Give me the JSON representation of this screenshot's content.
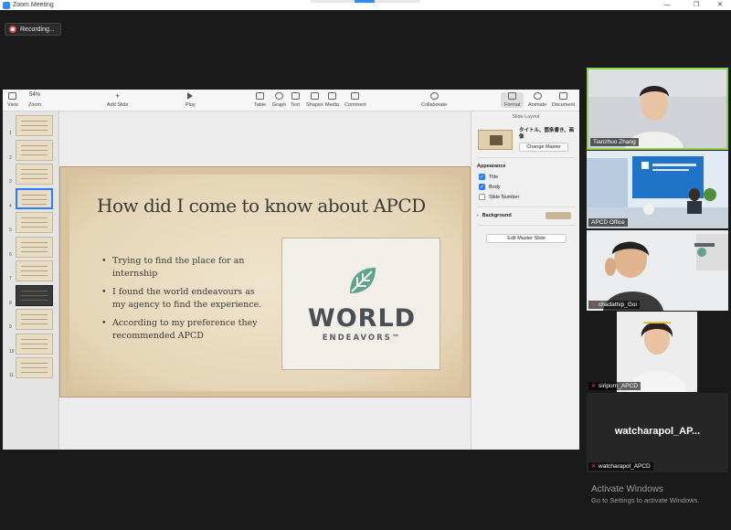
{
  "window": {
    "title": "Zoom Meeting"
  },
  "recording": {
    "label": "Recording..."
  },
  "keynote": {
    "toolbar": {
      "view": "View",
      "zoom_value": "54%",
      "zoom": "Zoom",
      "add_slide": "Add Slide",
      "play": "Play",
      "table": "Table",
      "graph": "Graph",
      "text": "Text",
      "shapes": "Shapes",
      "media": "Media",
      "comment": "Comment",
      "collaborate": "Collaborate",
      "format": "Format",
      "animate": "Animate",
      "document": "Document"
    },
    "slide_numbers": [
      "1",
      "2",
      "3",
      "4",
      "5",
      "6",
      "7",
      "8",
      "9",
      "10",
      "11"
    ],
    "selected_slide": 4,
    "slide": {
      "title": "How did I come to know about APCD",
      "bullets": [
        "Trying to find the place for an internship",
        "I found the world endeavours as my agency to find the experience.",
        "According to my preference they recommended APCD"
      ],
      "logo": {
        "line1": "WORLD",
        "line2": "ENDEAVORS™"
      },
      "colors": {
        "background": "#e9dcc2",
        "border": "#d8c2a0",
        "logo_leaf": "#5fa28f"
      }
    },
    "inspector": {
      "title": "Slide Layout",
      "master_name": "タイトル、箇条書き、画像",
      "change_master": "Change Master",
      "appearance": "Appearance",
      "options": [
        {
          "label": "Title",
          "checked": true
        },
        {
          "label": "Body",
          "checked": true
        },
        {
          "label": "Slide Number",
          "checked": false
        }
      ],
      "background": "Background",
      "edit_master": "Edit Master Slide"
    }
  },
  "participants": [
    {
      "name": "Tianzhuo Zhang",
      "muted": false,
      "active_speaker": true
    },
    {
      "name": "APCD Office",
      "muted": false
    },
    {
      "name": "chadathip_Goi",
      "muted": true
    },
    {
      "name": "siriporn_APCD",
      "muted": true
    },
    {
      "name": "watcharapol_APCD",
      "muted": true,
      "display": "watcharapol_AP..."
    }
  ],
  "activate_windows": {
    "title": "Activate Windows",
    "subtitle": "Go to Settings to activate Windows."
  }
}
